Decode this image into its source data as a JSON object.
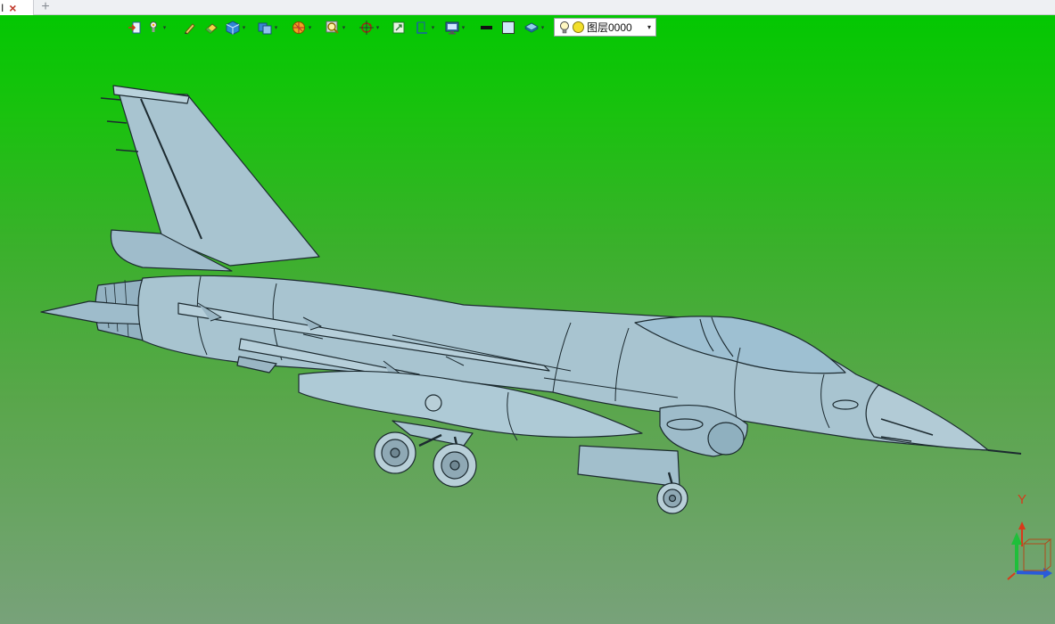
{
  "tabs": {
    "active_label": "I",
    "close_glyph": "×",
    "add_glyph": "+"
  },
  "toolbar": {
    "dropdown_glyph": "▾",
    "layer": {
      "name": "图层0000",
      "arrow": "▾"
    }
  },
  "triad": {
    "y_label": "Y"
  },
  "colors": {
    "viewport_top": "#00c800",
    "viewport_bottom": "#78a27a",
    "model_fill": "#a8c4d0",
    "model_shade": "#90b0bf",
    "model_stroke": "#1c2a30",
    "axis_x": "#2a5bd8",
    "axis_y": "#1fbf3a",
    "axis_z": "#d83a1a"
  }
}
